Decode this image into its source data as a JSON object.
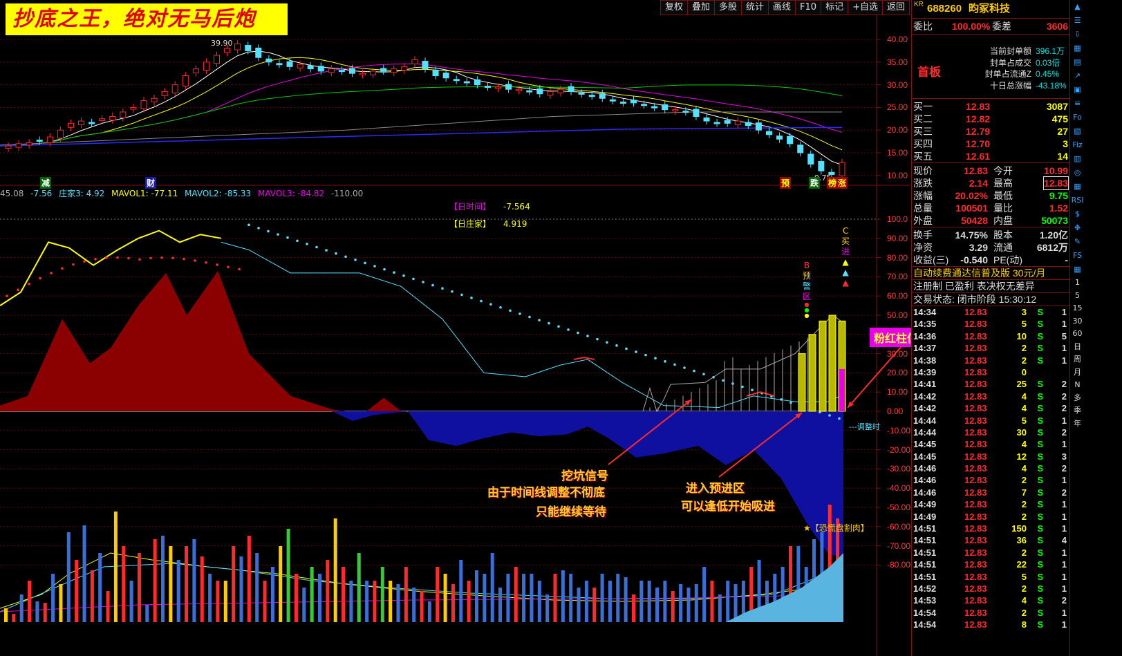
{
  "banner": "抄底之王，绝对无马后炮",
  "toolbar": [
    "复权",
    "叠加",
    "多股",
    "统计",
    "画线",
    "F10",
    "标记",
    "+自选",
    "返回"
  ],
  "price_axis": [
    "40.00",
    "35.00",
    "30.00",
    "25.00",
    "20.00",
    "15.00",
    "10.00"
  ],
  "price_hi_label": "39.90",
  "price_lo_label": "9.75",
  "markers_bottom": {
    "jian": "减",
    "cai": "财",
    "yu": "预",
    "die": "跌",
    "yu2": "榜",
    "zhang": "涨"
  },
  "indicator_line": {
    "v0": "45.08",
    "v1": "-7.56",
    "zj": "庄家3: 4.92",
    "ma1": "MAVOL1: -77.11",
    "ma2": "MAVOL2: -85.33",
    "ma3": "MAVOL3: -84.82",
    "v7": "-110.00"
  },
  "legend_box": {
    "l1": "【日时间】",
    "v1": "-7.564",
    "l2": "【日庄家】",
    "v2": "4.919"
  },
  "ind_axis": [
    "100.0",
    "90.00",
    "80.00",
    "70.00",
    "60.00",
    "50.00",
    "40.00",
    "30.00",
    "20.00",
    "10.00",
    "0.00",
    "-10.00",
    "-20.00",
    "-30.00",
    "-40.00",
    "-50.00",
    "-60.00",
    "-70.00",
    "-80.00"
  ],
  "side_labels": {
    "buy": [
      "C",
      "买",
      "进"
    ],
    "warn": [
      "B",
      "预",
      "警",
      "区"
    ],
    "adjust": "调整时",
    "panic": "【恐慌盘割肉】"
  },
  "annotations": {
    "a1": "挖坑信号",
    "a2": "由于时间线调整不彻底",
    "a3": "只能继续等待",
    "b1": "进入预进区",
    "b2": "可以逢低开始吸进",
    "pink": "粉红柱信号必须跟进"
  },
  "quote": {
    "code": "688260",
    "name": "昀冢科技",
    "prefix": "KR",
    "weibi_label": "委比",
    "weibi": "100.00%",
    "weicha_label": "委差",
    "weicha": "3606",
    "board": "首板",
    "seal_info": [
      {
        "k": "当前封单额",
        "v": "396.1万"
      },
      {
        "k": "封单占成交",
        "v": "0.03倍"
      },
      {
        "k": "封单占流通Z",
        "v": "0.45%"
      },
      {
        "k": "十日总涨幅",
        "v": "-43.18%"
      }
    ],
    "bids": [
      {
        "k": "买一",
        "p": "12.83",
        "q": "3087"
      },
      {
        "k": "买二",
        "p": "12.82",
        "q": "475"
      },
      {
        "k": "买三",
        "p": "12.79",
        "q": "27"
      },
      {
        "k": "买四",
        "p": "12.70",
        "q": "3"
      },
      {
        "k": "买五",
        "p": "12.61",
        "q": "14"
      }
    ],
    "stats": [
      {
        "k1": "现价",
        "v1": "12.83",
        "k2": "今开",
        "v2": "10.99"
      },
      {
        "k1": "涨跌",
        "v1": "2.14",
        "k2": "最高",
        "v2": "12.83"
      },
      {
        "k1": "涨幅",
        "v1": "20.02%",
        "k2": "最低",
        "v2": "9.75"
      },
      {
        "k1": "总量",
        "v1": "100501",
        "k2": "量比",
        "v2": "1.52"
      },
      {
        "k1": "外盘",
        "v1": "50428",
        "k2": "内盘",
        "v2": "50073"
      }
    ],
    "stats2": [
      {
        "k1": "换手",
        "v1": "14.75%",
        "k2": "股本",
        "v2": "1.20亿"
      },
      {
        "k1": "净资",
        "v1": "3.29",
        "k2": "流通",
        "v2": "6812万"
      },
      {
        "k1": "收益(三)",
        "v1": "-0.540",
        "k2": "PE(动)",
        "v2": "-"
      }
    ],
    "ad": "自动续费通达信普及版  30元/月",
    "reg": "注册制 已盈利 表决权无差异",
    "status": "交易状态: 闭市阶段  15:30:12"
  },
  "ticks": [
    [
      "14:34",
      "12.83",
      "3",
      "S",
      "1"
    ],
    [
      "14:35",
      "12.83",
      "5",
      "S",
      "1"
    ],
    [
      "14:36",
      "12.83",
      "10",
      "S",
      "5"
    ],
    [
      "14:37",
      "12.83",
      "2",
      "S",
      "1"
    ],
    [
      "14:38",
      "12.83",
      "2",
      "S",
      "1"
    ],
    [
      "14:39",
      "12.83",
      "0",
      "",
      ""
    ],
    [
      "14:41",
      "12.83",
      "25",
      "S",
      "2"
    ],
    [
      "14:42",
      "12.83",
      "4",
      "S",
      "2"
    ],
    [
      "14:42",
      "12.83",
      "4",
      "S",
      "2"
    ],
    [
      "14:44",
      "12.83",
      "5",
      "S",
      "1"
    ],
    [
      "14:44",
      "12.83",
      "30",
      "S",
      "2"
    ],
    [
      "14:45",
      "12.83",
      "4",
      "S",
      "1"
    ],
    [
      "14:45",
      "12.83",
      "12",
      "S",
      "3"
    ],
    [
      "14:46",
      "12.83",
      "4",
      "S",
      "2"
    ],
    [
      "14:46",
      "12.83",
      "2",
      "S",
      "1"
    ],
    [
      "14:46",
      "12.83",
      "7",
      "S",
      "2"
    ],
    [
      "14:49",
      "12.83",
      "2",
      "S",
      "1"
    ],
    [
      "14:49",
      "12.83",
      "2",
      "S",
      "1"
    ],
    [
      "14:51",
      "12.83",
      "150",
      "S",
      "1"
    ],
    [
      "14:51",
      "12.83",
      "36",
      "S",
      "4"
    ],
    [
      "14:51",
      "12.83",
      "2",
      "S",
      "1"
    ],
    [
      "14:51",
      "12.83",
      "22",
      "S",
      "1"
    ],
    [
      "14:51",
      "12.83",
      "5",
      "S",
      "1"
    ],
    [
      "14:52",
      "12.83",
      "2",
      "S",
      "1"
    ],
    [
      "14:53",
      "12.83",
      "4",
      "S",
      "2"
    ],
    [
      "14:54",
      "12.83",
      "2",
      "S",
      "1"
    ],
    [
      "14:54",
      "12.83",
      "8",
      "S",
      "1"
    ]
  ],
  "sidebar_text": [
    "1",
    "5",
    "15",
    "30",
    "60",
    "日",
    "周",
    "月",
    "N",
    "多",
    "季",
    "年"
  ],
  "colors": {
    "up": "#ff2a2a",
    "down": "#55e0ff",
    "grid": "#7a1010",
    "yellow": "#ffff00",
    "magenta": "#e800e8",
    "green": "#00ff00",
    "navy": "#1818a8",
    "dark_red": "#8b0000"
  }
}
